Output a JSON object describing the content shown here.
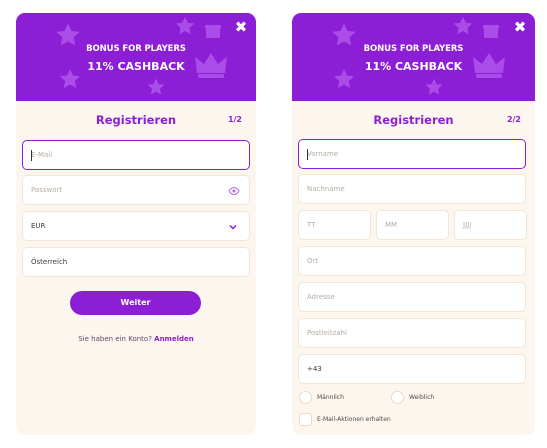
{
  "colors": {
    "brand": "#8c1fd6",
    "panel_bg": "#fdf6ee",
    "field_border": "#f1e6d8"
  },
  "icons": {
    "close": "close-icon",
    "eye": "eye-icon",
    "chevron": "chevron-down-icon",
    "star": "star-icon",
    "crown": "crown-icon",
    "gift": "gift-icon"
  },
  "left": {
    "banner": {
      "line1": "BONUS FOR PLAYERS",
      "line2": "11% CASHBACK",
      "close": "✖"
    },
    "title": "Registrieren",
    "step": "1/2",
    "email": {
      "placeholder": "E-Mail"
    },
    "password": {
      "placeholder": "Passwort"
    },
    "currency": {
      "value": "EUR"
    },
    "country": {
      "value": "Österreich"
    },
    "submit": "Weiter",
    "login_prompt": "Sie haben ein Konto?",
    "login_link": "Anmelden"
  },
  "right": {
    "banner": {
      "line1": "BONUS FOR PLAYERS",
      "line2": "11% CASHBACK",
      "close": "✖"
    },
    "title": "Registrieren",
    "step": "2/2",
    "firstname": {
      "placeholder": "Vorname"
    },
    "lastname": {
      "placeholder": "Nachname"
    },
    "day": {
      "placeholder": "TT"
    },
    "month": {
      "placeholder": "MM"
    },
    "year": {
      "placeholder": "JJJJ"
    },
    "city": {
      "placeholder": "Ort"
    },
    "address": {
      "placeholder": "Adresse"
    },
    "zip": {
      "placeholder": "Postleitzahl"
    },
    "phone": {
      "value": "+43"
    },
    "gender_male": "Männlich",
    "gender_female": "Weiblich",
    "email_offers": "E-Mail-Aktionen erhalten"
  }
}
